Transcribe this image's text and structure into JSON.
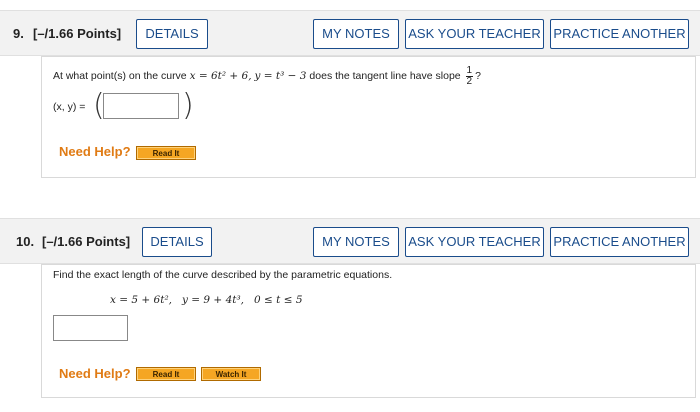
{
  "q9": {
    "number": "9.",
    "points": "[–/1.66 Points]",
    "details_label": "DETAILS",
    "my_notes_label": "MY NOTES",
    "ask_teacher_label": "ASK YOUR TEACHER",
    "practice_label": "PRACTICE ANOTHER",
    "question_prefix": "At what point(s) on the curve",
    "eq_x": "x = 6t² + 6,",
    "eq_y": "y = t³ − 3",
    "question_suffix": "does the tangent line have slope",
    "slope_num": "1",
    "slope_den": "2",
    "question_mark": "?",
    "point_label": "(x, y) =",
    "answer_value": "",
    "need_help": "Need Help?",
    "read_it": "Read It"
  },
  "q10": {
    "number": "10.",
    "points": "[–/1.66 Points]",
    "details_label": "DETAILS",
    "my_notes_label": "MY NOTES",
    "ask_teacher_label": "ASK YOUR TEACHER",
    "practice_label": "PRACTICE ANOTHER",
    "question_text": "Find the exact length of the curve described by the parametric equations.",
    "equations": "x = 5 + 6t²,   y = 9 + 4t³,   0 ≤ t ≤ 5",
    "answer_value": "",
    "need_help": "Need Help?",
    "read_it": "Read It",
    "watch_it": "Watch It"
  },
  "colors": {
    "accent": "#1a4c8b",
    "help_orange": "#e07b14",
    "button_orange": "#f5a623",
    "header_bg": "#f2f2f2"
  }
}
